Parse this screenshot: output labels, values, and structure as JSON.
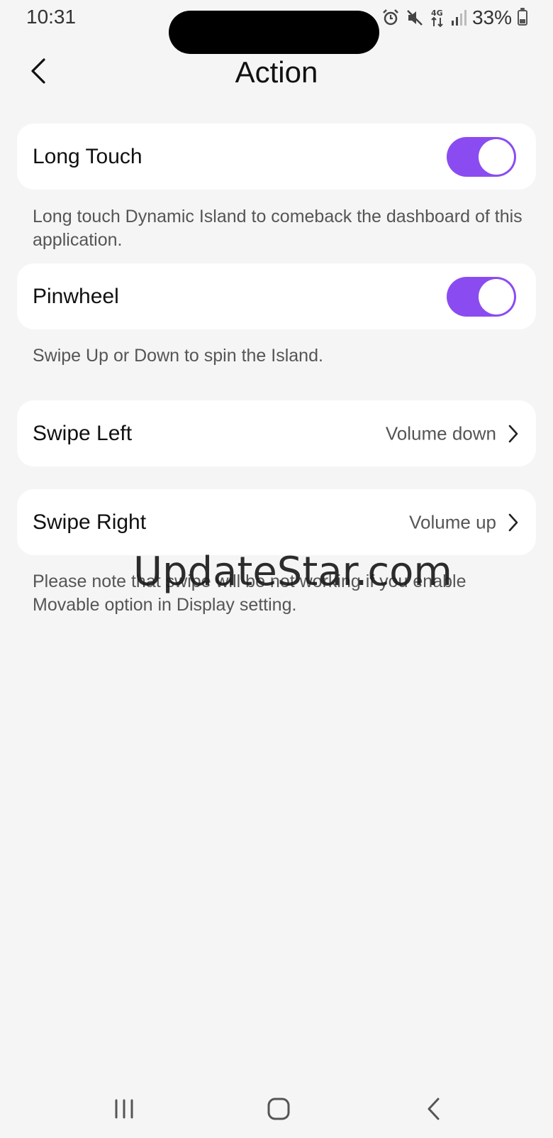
{
  "status_bar": {
    "time": "10:31",
    "battery_percent": "33%",
    "icons": [
      "alarm-icon",
      "mute-icon",
      "4g-icon",
      "signal-icon",
      "battery-icon"
    ]
  },
  "header": {
    "title": "Action",
    "back_icon": "chevron-left-icon"
  },
  "settings": {
    "long_touch": {
      "label": "Long Touch",
      "enabled": true,
      "description": "Long touch Dynamic Island to comeback the dashboard of this application."
    },
    "pinwheel": {
      "label": "Pinwheel",
      "enabled": true,
      "description": "Swipe Up or Down to spin the Island."
    },
    "swipe_left": {
      "label": "Swipe Left",
      "value": "Volume down"
    },
    "swipe_right": {
      "label": "Swipe Right",
      "value": "Volume up"
    },
    "swipe_note": "Please note that swipe will be not working if you enable Movable option in Display setting."
  },
  "watermark": "UpdateStar.com",
  "colors": {
    "accent": "#8a4cf0",
    "background": "#f5f5f5",
    "card": "#ffffff"
  },
  "nav_bar": {
    "icons": [
      "recent-apps-icon",
      "home-icon",
      "back-icon"
    ]
  }
}
